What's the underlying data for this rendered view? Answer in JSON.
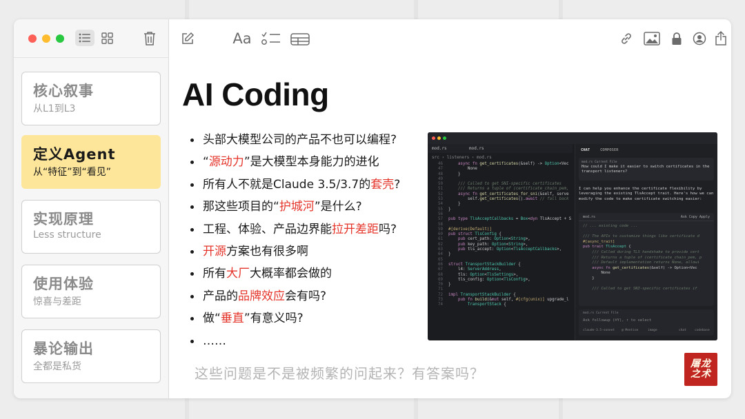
{
  "window": {
    "controls": [
      "close",
      "minimize",
      "zoom"
    ]
  },
  "sidebar_toolbar": {
    "icons": [
      "list-view-icon",
      "gallery-view-icon",
      "trash-icon"
    ]
  },
  "main_toolbar": {
    "format_label": "Aa",
    "icons": [
      "compose-icon",
      "checklist-icon",
      "table-icon",
      "link-icon",
      "media-icon",
      "lock-icon",
      "collaborate-icon",
      "share-icon"
    ]
  },
  "notes": [
    {
      "title": "核心叙事",
      "subtitle": "从L1到L3",
      "selected": false
    },
    {
      "title": "定义Agent",
      "subtitle": "从“特征”到“看见”",
      "selected": true
    },
    {
      "title": "实现原理",
      "subtitle": "Less structure",
      "selected": false
    },
    {
      "title": "使用体验",
      "subtitle": "惊喜与差距",
      "selected": false
    },
    {
      "title": "暴论输出",
      "subtitle": "全都是私货",
      "selected": false
    }
  ],
  "content": {
    "title": "AI Coding",
    "bullets": [
      {
        "pre": "头部大模型公司的产品不也可以编程?",
        "hl": "",
        "post": ""
      },
      {
        "pre": "“",
        "hl": "源动力",
        "post": "”是大模型本身能力的进化"
      },
      {
        "pre": "所有人不就是Claude 3.5/3.7的",
        "hl": "套壳",
        "post": "?"
      },
      {
        "pre": "那这些项目的“",
        "hl": "护城河",
        "post": "”是什么?"
      },
      {
        "pre": "工程、体验、产品边界能",
        "hl": "拉开差距",
        "post": "吗?"
      },
      {
        "pre": "",
        "hl": "开源",
        "post": "方案也有很多啊"
      },
      {
        "pre": "所有",
        "hl": "大厂",
        "post": "大概率都会做的"
      },
      {
        "pre": "产品的",
        "hl": "品牌效应",
        "post": "会有吗?"
      },
      {
        "pre": "做“",
        "hl": "垂直",
        "post": "”有意义吗?"
      },
      {
        "pre": "……",
        "hl": "",
        "post": ""
      }
    ],
    "footer_question": "这些问题是不是被频繁的问起来？有答案吗？",
    "highlight_color": "#e5352b"
  },
  "screenshot": {
    "tab1": "mod.rs",
    "tab2": "mod.rs",
    "path": "src › listeners › mod.rs",
    "panel_tab_chat": "CHAT",
    "panel_tab_composer": "COMPOSER",
    "question_file": "mod.rs Current File",
    "question": "How could I make it easier to switch certificates in the transport listeners?",
    "answer": "I can help you enhance the certificate flexibility by leveraging the existing TlsAccept trait. Here's how we can modify the code to make certificate switching easier:",
    "code_file": "mod.rs",
    "code_actions": "Ask  Copy  Apply",
    "followup_file": "mod.rs Current File",
    "followup": "Ask followup (⌘Y), ↑ to select",
    "model": "claude-3.5-sonnet",
    "mention": "@ Mention",
    "image": "image",
    "chat_btn": "chat",
    "codebase_btn": "codebase"
  },
  "seal": {
    "line1": "屠龙",
    "line2": "之术"
  },
  "colors": {
    "selected_note": "#fde69a",
    "sidebar_bg": "#f6f6f6",
    "traffic_red": "#fe5f57",
    "traffic_yellow": "#febc2e",
    "traffic_green": "#28c840"
  }
}
